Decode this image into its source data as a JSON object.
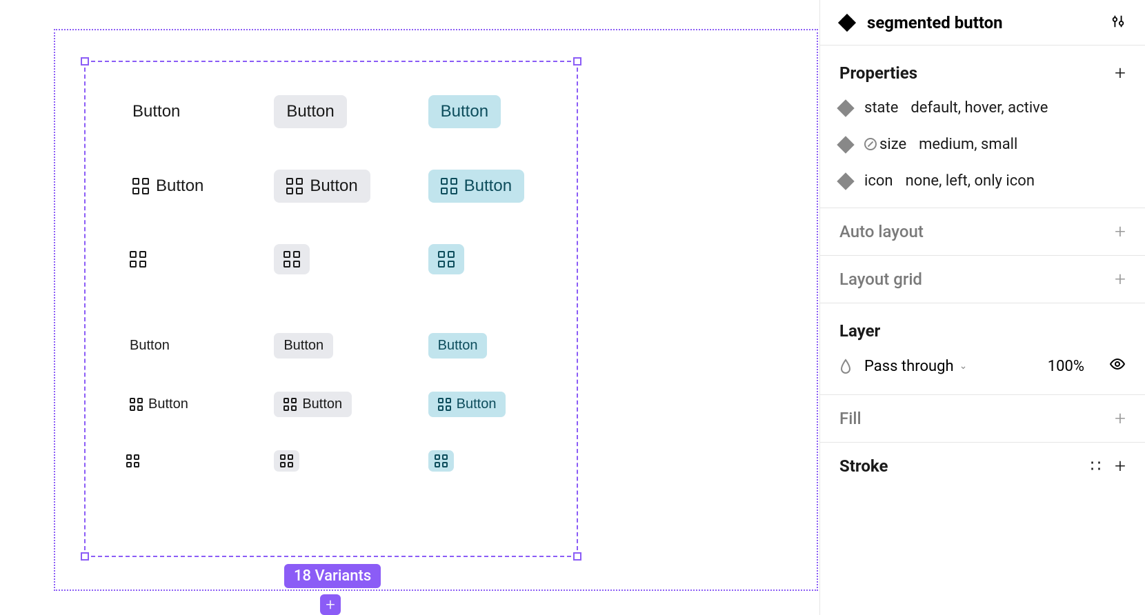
{
  "component_name": "segmented button",
  "variants_badge": "18 Variants",
  "button_label": "Button",
  "panel": {
    "properties_title": "Properties",
    "props": [
      {
        "name": "state",
        "values": "default, hover, active",
        "unused": false
      },
      {
        "name": "size",
        "values": "medium, small",
        "unused": true
      },
      {
        "name": "icon",
        "values": "none, left, only icon",
        "unused": false
      }
    ],
    "auto_layout": "Auto layout",
    "layout_grid": "Layout grid",
    "layer_title": "Layer",
    "blend_mode": "Pass through",
    "opacity": "100%",
    "fill_title": "Fill",
    "stroke_title": "Stroke"
  }
}
